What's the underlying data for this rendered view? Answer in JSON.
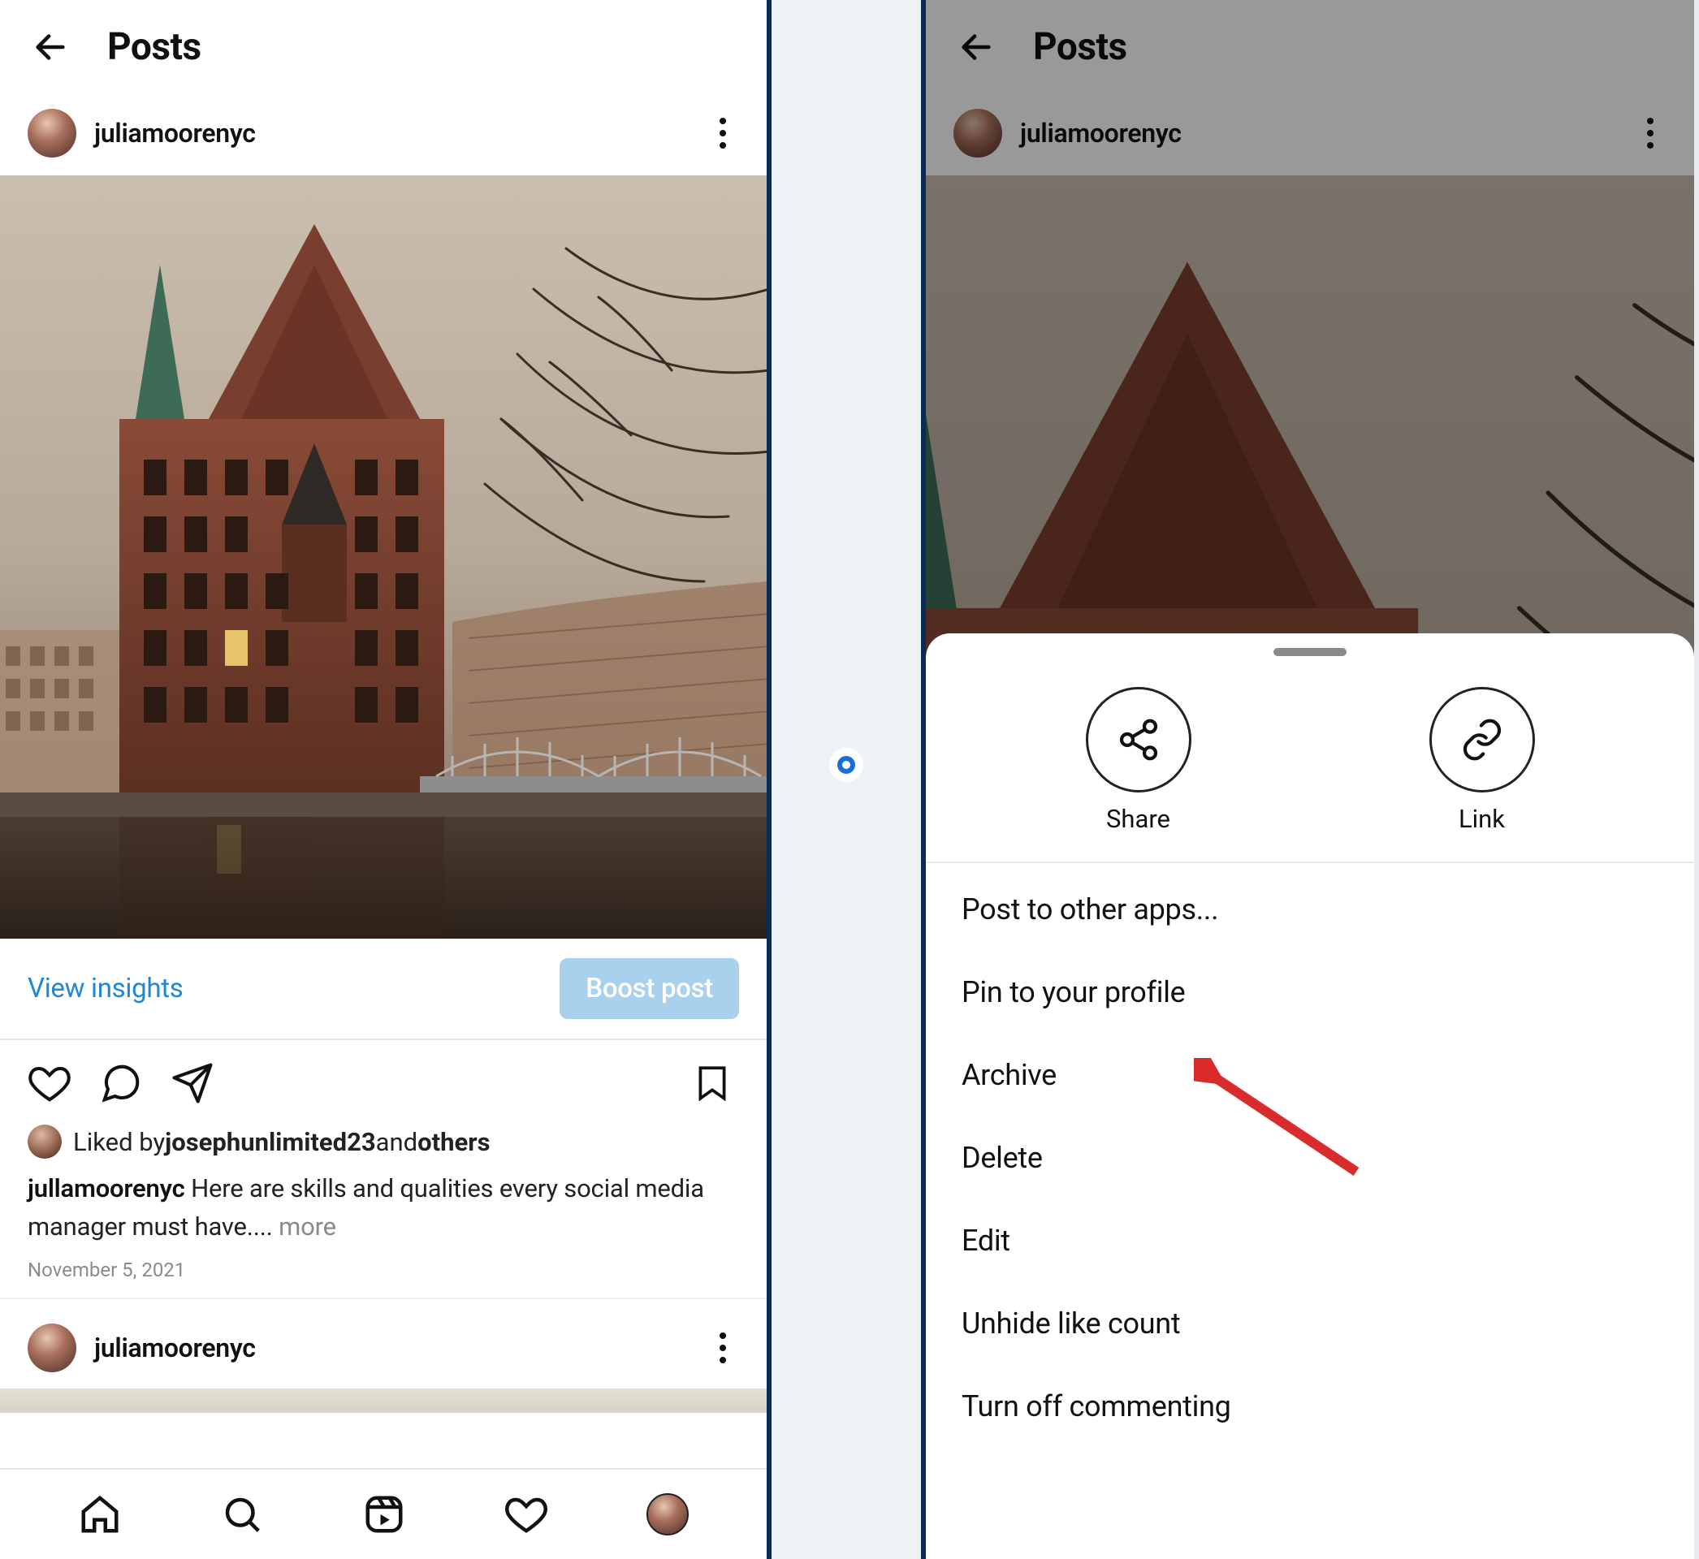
{
  "left": {
    "header_title": "Posts",
    "username": "juliamoorenyc",
    "view_insights": "View insights",
    "boost": "Boost post",
    "liked_prefix": "Liked by ",
    "liked_name": "josephunlimited23",
    "liked_suffix": " and ",
    "liked_others": "others",
    "caption_user": "jullamoorenyc",
    "caption_text": " Here are skills and qualities every social media manager must have.... ",
    "caption_more": "more",
    "date": "November 5, 2021",
    "username2": "juliamoorenyc"
  },
  "right": {
    "header_title": "Posts",
    "username": "juliamoorenyc",
    "share": "Share",
    "link": "Link",
    "menu": [
      "Post to other apps...",
      "Pin to your profile",
      "Archive",
      "Delete",
      "Edit",
      "Unhide like count",
      "Turn off commenting"
    ]
  }
}
